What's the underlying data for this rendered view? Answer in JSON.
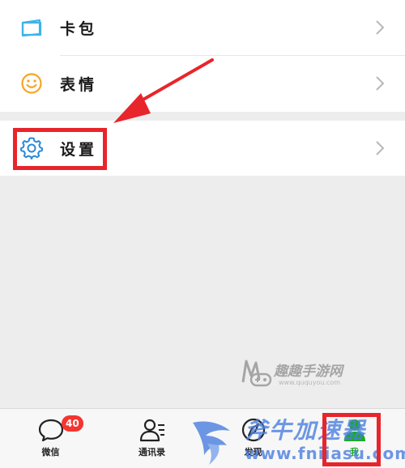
{
  "menu": {
    "cards_label": "卡包",
    "stickers_label": "表情",
    "settings_label": "设置"
  },
  "icons": {
    "cards": "card-icon",
    "stickers": "smiley-icon",
    "settings": "gear-icon",
    "chevron": "chevron-right-icon"
  },
  "tabbar": {
    "chats_label": "微信",
    "chats_badge": "40",
    "contacts_label": "通讯录",
    "discover_label": "发现",
    "me_label": "我"
  },
  "watermark": {
    "text": "趣趣手游网",
    "url": "www.ququyou.com"
  },
  "brand_watermark": {
    "text": "斧牛加速器",
    "url": "www.fniiasu.com"
  },
  "colors": {
    "highlight": "#e8252b",
    "card_icon": "#3bb4e8",
    "smiley_icon": "#f6a623",
    "gear_icon": "#2a8ad8",
    "active_tab": "#1aad19",
    "badge": "#f43530"
  }
}
